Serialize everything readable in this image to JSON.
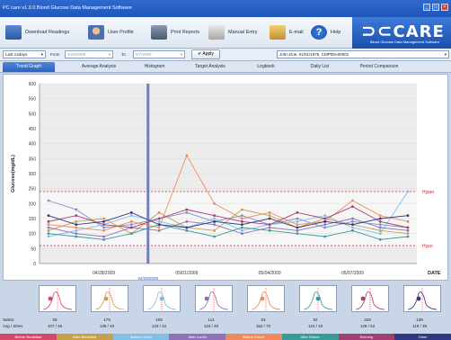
{
  "app": {
    "title": "PC care v1.0.0 Blood Glucose Data Management Software"
  },
  "toolbar": {
    "download": "Download Readings",
    "profile": "User Profile",
    "print": "Print Reports",
    "manual": "Manual Entry",
    "email": "E-mail",
    "help": "Help",
    "logo": "CARE",
    "logo_sub": "Blood Glucose Data Management Software"
  },
  "filter": {
    "range": "Last 14days",
    "from_label": "From",
    "from_value": "4/25/2009",
    "to_label": "To",
    "to_value": "5/7/2009",
    "apply": "Apply",
    "patient": "John Doe, 01/01/1975, CMP00A00001"
  },
  "tabs": [
    "Trend Graph",
    "Average Analysis",
    "Histogram",
    "Target Analysis",
    "Logbook",
    "Daily List",
    "Period Comparison"
  ],
  "chart_data": {
    "type": "line",
    "ylabel": "Glucose(mg/dL)",
    "xlabel": "DATE",
    "ylim": [
      0,
      600
    ],
    "yticks": [
      0,
      50,
      100,
      150,
      200,
      250,
      300,
      350,
      400,
      450,
      500,
      550,
      600
    ],
    "xticks": [
      "04/28/2009",
      "05/01/2009",
      "05/04/2009",
      "05/07/2009"
    ],
    "cursor_label": "04/29/2009",
    "hyper": 240,
    "hypo": 60,
    "hyper_label": "Hyper",
    "hypo_label": "Hypo",
    "series": [
      {
        "color": "#7b8fc9",
        "values": [
          210,
          180,
          120,
          130,
          150,
          170,
          140,
          160,
          130,
          150,
          120,
          140,
          130,
          120
        ]
      },
      {
        "color": "#c7a14a",
        "values": [
          110,
          140,
          150,
          100,
          170,
          120,
          110,
          180,
          160,
          120,
          150,
          130,
          110,
          100
        ]
      },
      {
        "color": "#7fc0e8",
        "values": [
          90,
          110,
          130,
          160,
          140,
          120,
          150,
          110,
          130,
          140,
          160,
          120,
          100,
          240
        ]
      },
      {
        "color": "#9070b8",
        "values": [
          120,
          100,
          90,
          120,
          110,
          140,
          130,
          100,
          120,
          110,
          130,
          150,
          120,
          110
        ]
      },
      {
        "color": "#f08a5a",
        "values": [
          130,
          120,
          110,
          140,
          120,
          360,
          200,
          150,
          170,
          130,
          140,
          210,
          160,
          140
        ]
      },
      {
        "color": "#3a9a9a",
        "values": [
          100,
          90,
          80,
          100,
          130,
          110,
          90,
          120,
          110,
          100,
          90,
          110,
          80,
          90
        ]
      },
      {
        "color": "#a04070",
        "values": [
          140,
          160,
          130,
          120,
          150,
          180,
          160,
          140,
          130,
          170,
          150,
          190,
          140,
          120
        ]
      },
      {
        "color": "#303a80",
        "values": [
          160,
          130,
          140,
          170,
          130,
          120,
          140,
          130,
          150,
          120,
          140,
          130,
          150,
          160
        ]
      }
    ]
  },
  "summary": {
    "select_label": "Select",
    "avg_label": "Avg / SDev",
    "groups": [
      {
        "name": "Before Breakfast",
        "color": "#d8466a",
        "count": "59",
        "avg": "107 / 46"
      },
      {
        "name": "After Breakfast",
        "color": "#c7a14a",
        "count": "179",
        "avg": "138 / 40"
      },
      {
        "name": "Before Lunch",
        "color": "#7fc0e8",
        "count": "109",
        "avg": "133 / 42"
      },
      {
        "name": "After Lunch",
        "color": "#9070b8",
        "count": "114",
        "avg": "124 / 40"
      },
      {
        "name": "Before Dinner",
        "color": "#f08a5a",
        "count": "93",
        "avg": "152 / 70"
      },
      {
        "name": "After Dinner",
        "color": "#3a9a9a",
        "count": "92",
        "avg": "124 / 33"
      },
      {
        "name": "Evening",
        "color": "#a04070",
        "count": "229",
        "avg": "129 / 52"
      },
      {
        "name": "Other",
        "color": "#303a80",
        "count": "139",
        "avg": "119 / 35"
      }
    ]
  }
}
